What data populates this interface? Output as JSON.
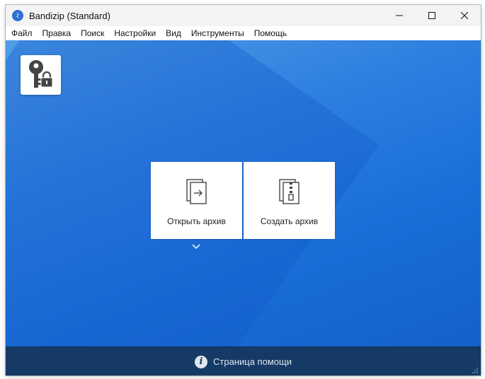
{
  "window": {
    "title": "Bandizip (Standard)",
    "controls": {
      "minimize_icon": "minimize-icon",
      "maximize_icon": "maximize-icon",
      "close_icon": "close-icon"
    }
  },
  "menu": {
    "items": [
      "Файл",
      "Правка",
      "Поиск",
      "Настройки",
      "Вид",
      "Инструменты",
      "Помощь"
    ]
  },
  "main": {
    "key_tile_icon": "key-lock-icon",
    "open_archive": {
      "label": "Открыть архив",
      "icon": "open-archive-icon"
    },
    "create_archive": {
      "label": "Создать архив",
      "icon": "zip-archive-icon"
    },
    "dropdown_icon": "chevron-down-icon"
  },
  "footer": {
    "help_label": "Страница помощи",
    "help_icon": "info-icon"
  },
  "colors": {
    "background_gradient_start": "#4f9ee6",
    "background_gradient_end": "#1560c9",
    "footer_bg": "#153a66",
    "app_icon": "#2f6fd0"
  }
}
